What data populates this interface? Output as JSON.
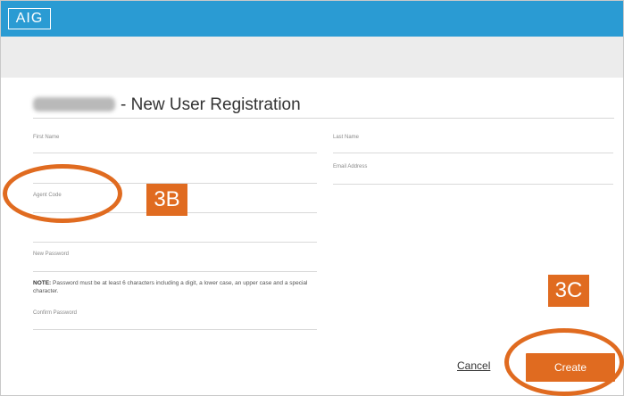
{
  "header": {
    "logo_text": "AIG"
  },
  "page": {
    "title": "- New User Registration"
  },
  "form": {
    "left_fields": [
      "First Name",
      "Agent Code",
      "New Password",
      "Confirm Password"
    ],
    "right_fields": [
      "Last Name",
      "Email Address"
    ],
    "note_label": "NOTE:",
    "note_text": " Password must be at least 6 characters including a digit, a lower case, an upper case and a special character."
  },
  "actions": {
    "cancel_label": "Cancel",
    "create_label": "Create"
  },
  "annotations": {
    "step_b": "3B",
    "step_c": "3C"
  },
  "colors": {
    "brand_blue": "#2a9bd3",
    "accent_orange": "#e06b20",
    "toolbar_gray": "#ececec"
  }
}
